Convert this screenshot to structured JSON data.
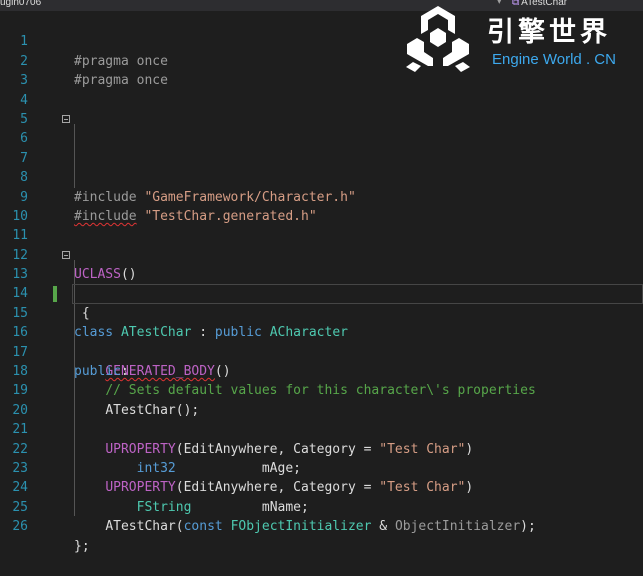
{
  "topbar": {
    "left_text": "ugin0706",
    "dropdown_arrow": "▾",
    "right_text": "ATestChar",
    "right_icon": "class-symbol-icon"
  },
  "watermark": {
    "title": "引擎世界",
    "subtitle": "Engine World . CN",
    "logo_icon": "engine-world-logo-icon"
  },
  "editor": {
    "current_line": 15,
    "lines": [
      {
        "n": "1"
      },
      {
        "n": "2"
      },
      {
        "n": "3"
      },
      {
        "n": "4"
      },
      {
        "n": "5"
      },
      {
        "n": "6"
      },
      {
        "n": "7"
      },
      {
        "n": "8"
      },
      {
        "n": "9"
      },
      {
        "n": "10"
      },
      {
        "n": "11"
      },
      {
        "n": "12"
      },
      {
        "n": "13"
      },
      {
        "n": "14"
      },
      {
        "n": "15"
      },
      {
        "n": "16"
      },
      {
        "n": "17"
      },
      {
        "n": "18"
      },
      {
        "n": "19"
      },
      {
        "n": "20"
      },
      {
        "n": "21"
      },
      {
        "n": "22"
      },
      {
        "n": "23"
      },
      {
        "n": "24"
      },
      {
        "n": "25"
      },
      {
        "n": "26"
      }
    ],
    "t": {
      "pragma": "#pragma once",
      "include": "#include",
      "space": " ",
      "inc1_path": "\"GameFramework/Character.h\"",
      "inc2_path": "\"TestChar.generated.h\"",
      "uclass": "UCLASS",
      "parens": "()",
      "kw_class": "class",
      "cls_name": "ATestChar",
      "colon_sep": " : ",
      "kw_public": "public",
      "base_name": "ACharacter",
      "brace_open": "{",
      "generated_body": "GENERATED_BODY",
      "public_label": "public",
      "colon": ":",
      "comment": "// Sets default values for this character\\'s properties",
      "ctor_call": "ATestChar();",
      "uproperty": "UPROPERTY",
      "paren_open": "(",
      "prop_args": "EditAnywhere, Category = ",
      "cat_str": "\"Test Char\"",
      "paren_close": ")",
      "type_int32": "int32",
      "var_age": "           mAge;",
      "type_fstring": "FString",
      "var_name": "         mName;",
      "ctor_name": "ATestChar",
      "kw_const": "const",
      "obj_init_type": "FObjectInitializer",
      "amp_sep": " & ",
      "obj_init_param": "ObjectInitialzer",
      "end_call": ");",
      "brace_close": "};"
    }
  }
}
